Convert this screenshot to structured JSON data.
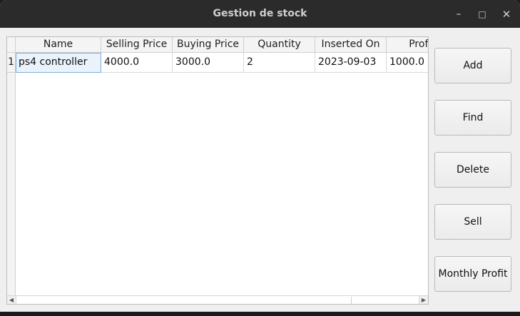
{
  "window": {
    "title": "Gestion de stock",
    "controls": {
      "minimize": "–",
      "maximize": "□",
      "close": "✕"
    }
  },
  "table": {
    "columns": [
      "Name",
      "Selling Price",
      "Buying Price",
      "Quantity",
      "Inserted On",
      "Profit"
    ],
    "rows": [
      {
        "index": "1",
        "cells": [
          "ps4 controller",
          "4000.0",
          "3000.0",
          "2",
          "2023-09-03",
          "1000.0"
        ]
      }
    ],
    "scroll_arrows": {
      "left": "◀",
      "right": "▶"
    }
  },
  "actions": {
    "add": "Add",
    "find": "Find",
    "delete": "Delete",
    "sell": "Sell",
    "monthly_profit": "Monthly Profit"
  }
}
